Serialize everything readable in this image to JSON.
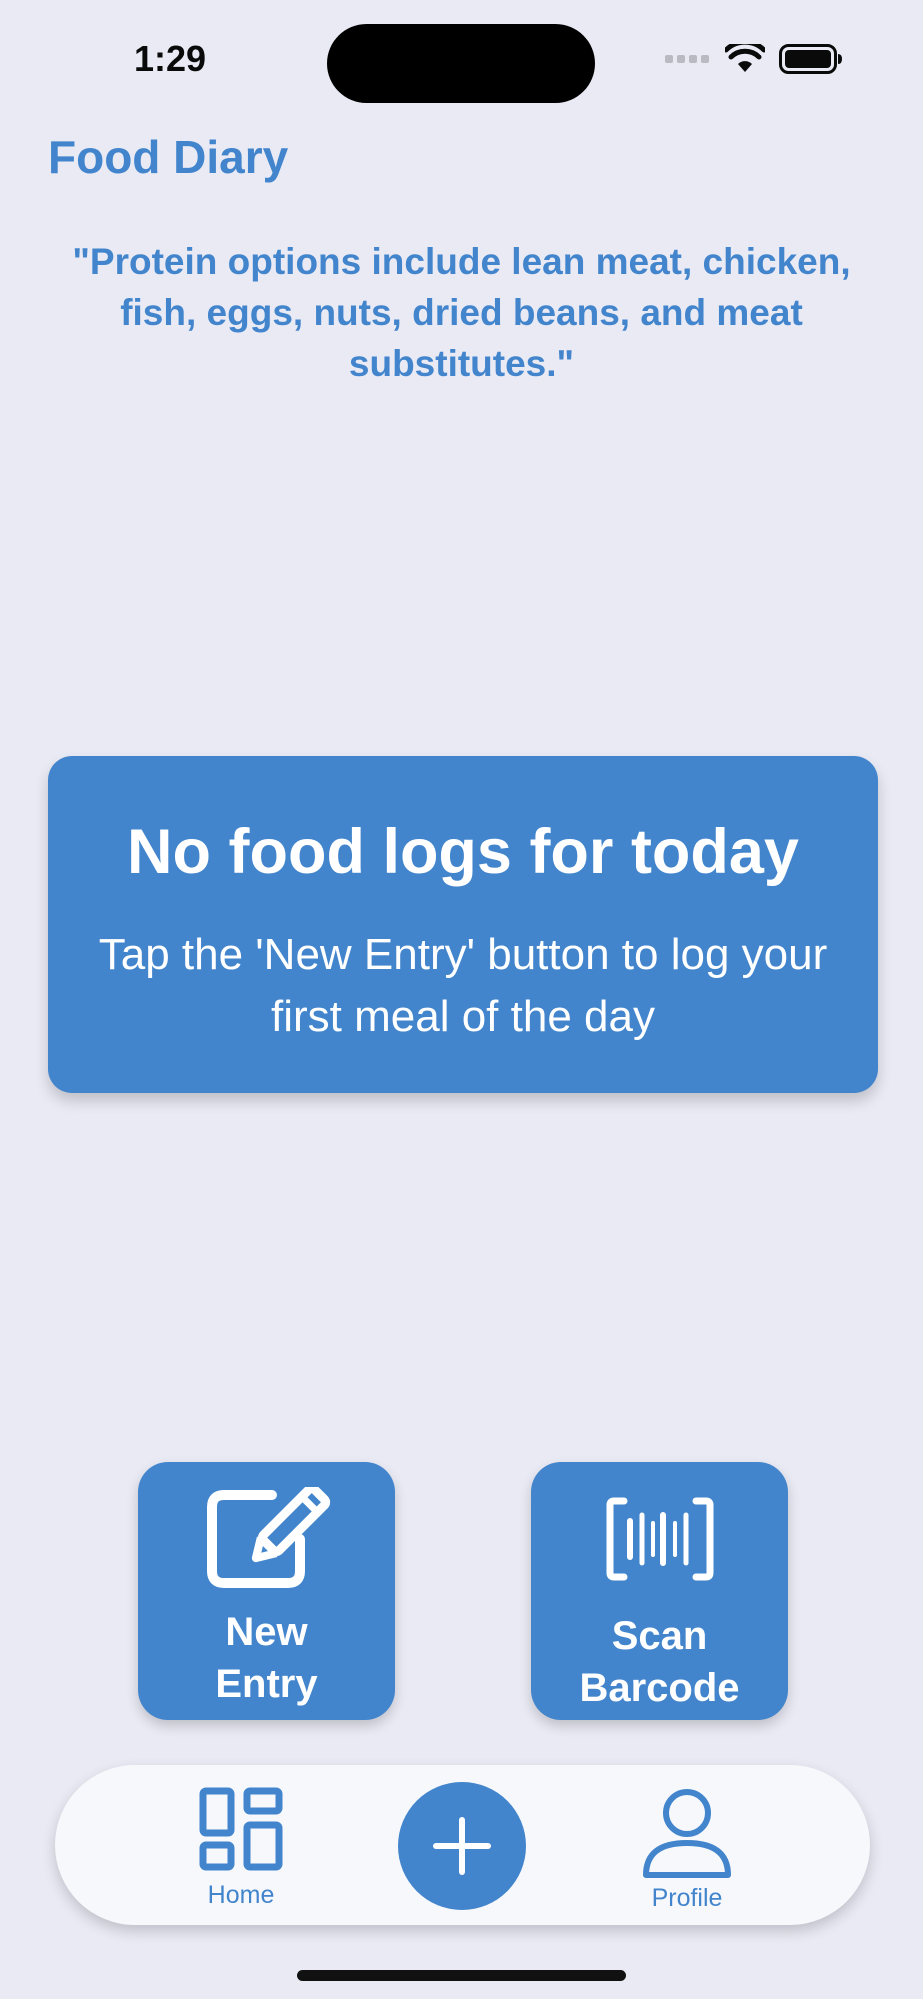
{
  "status_bar": {
    "time": "1:29"
  },
  "header": {
    "title": "Food Diary"
  },
  "tip": {
    "quote": "\"Protein options include lean meat, chicken, fish, eggs, nuts, dried beans, and meat substitutes.\""
  },
  "empty_state": {
    "title": "No food logs for today",
    "message": "Tap the 'New Entry' button to log your first meal of the day"
  },
  "actions": {
    "new_entry": {
      "label": "New\nEntry",
      "icon": "edit-icon"
    },
    "scan_barcode": {
      "label": "Scan\nBarcode",
      "icon": "barcode-icon"
    }
  },
  "tab_bar": {
    "home_label": "Home",
    "home_icon": "grid-icon",
    "add_icon": "plus-icon",
    "profile_label": "Profile",
    "profile_icon": "person-icon"
  },
  "colors": {
    "accent": "#4285cc",
    "background": "#e9eaf4",
    "tab_bar": "#f7f8fc"
  }
}
